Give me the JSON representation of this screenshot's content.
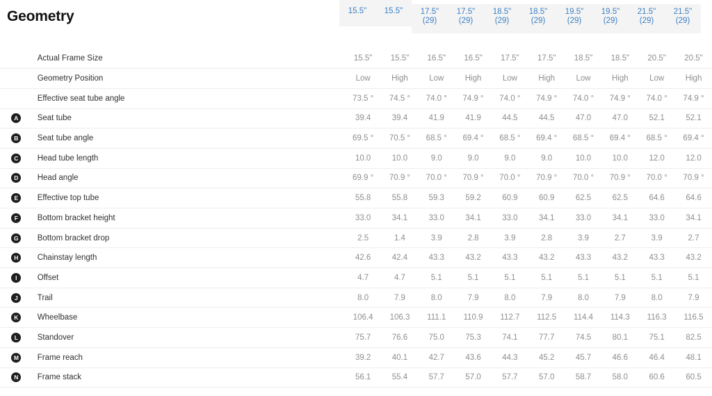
{
  "page_title": "Geometry",
  "colors": {
    "header_text": "#3a7fc4",
    "header_bg": "#f4f4f4",
    "label_text": "#2f2f2f",
    "value_text": "#8e8e8e",
    "badge_bg": "#1f1f1f",
    "row_divider": "#ededed"
  },
  "size_tabs": [
    {
      "size": "15.5\"",
      "wheel": "",
      "selected": true
    },
    {
      "size": "15.5\"",
      "wheel": "",
      "selected": true
    },
    {
      "size": "17.5\"",
      "wheel": "(29)",
      "selected": false
    },
    {
      "size": "17.5\"",
      "wheel": "(29)",
      "selected": false
    },
    {
      "size": "18.5\"",
      "wheel": "(29)",
      "selected": false
    },
    {
      "size": "18.5\"",
      "wheel": "(29)",
      "selected": false
    },
    {
      "size": "19.5\"",
      "wheel": "(29)",
      "selected": false
    },
    {
      "size": "19.5\"",
      "wheel": "(29)",
      "selected": false
    },
    {
      "size": "21.5\"",
      "wheel": "(29)",
      "selected": false
    },
    {
      "size": "21.5\"",
      "wheel": "(29)",
      "selected": false
    }
  ],
  "rows": [
    {
      "badge": "",
      "label": "Actual Frame Size",
      "values": [
        "15.5\"",
        "15.5\"",
        "16.5\"",
        "16.5\"",
        "17.5\"",
        "17.5\"",
        "18.5\"",
        "18.5\"",
        "20.5\"",
        "20.5\""
      ]
    },
    {
      "badge": "",
      "label": "Geometry Position",
      "values": [
        "Low",
        "High",
        "Low",
        "High",
        "Low",
        "High",
        "Low",
        "High",
        "Low",
        "High"
      ]
    },
    {
      "badge": "",
      "label": "Effective seat tube angle",
      "values": [
        "73.5 °",
        "74.5 °",
        "74.0 °",
        "74.9 °",
        "74.0 °",
        "74.9 °",
        "74.0 °",
        "74.9 °",
        "74.0 °",
        "74.9 °"
      ]
    },
    {
      "badge": "A",
      "label": "Seat tube",
      "values": [
        "39.4",
        "39.4",
        "41.9",
        "41.9",
        "44.5",
        "44.5",
        "47.0",
        "47.0",
        "52.1",
        "52.1"
      ]
    },
    {
      "badge": "B",
      "label": "Seat tube angle",
      "values": [
        "69.5 °",
        "70.5 °",
        "68.5 °",
        "69.4 °",
        "68.5 °",
        "69.4 °",
        "68.5 °",
        "69.4 °",
        "68.5 °",
        "69.4 °"
      ]
    },
    {
      "badge": "C",
      "label": "Head tube length",
      "values": [
        "10.0",
        "10.0",
        "9.0",
        "9.0",
        "9.0",
        "9.0",
        "10.0",
        "10.0",
        "12.0",
        "12.0"
      ]
    },
    {
      "badge": "D",
      "label": "Head angle",
      "values": [
        "69.9 °",
        "70.9 °",
        "70.0 °",
        "70.9 °",
        "70.0 °",
        "70.9 °",
        "70.0 °",
        "70.9 °",
        "70.0 °",
        "70.9 °"
      ]
    },
    {
      "badge": "E",
      "label": "Effective top tube",
      "values": [
        "55.8",
        "55.8",
        "59.3",
        "59.2",
        "60.9",
        "60.9",
        "62.5",
        "62.5",
        "64.6",
        "64.6"
      ]
    },
    {
      "badge": "F",
      "label": "Bottom bracket height",
      "values": [
        "33.0",
        "34.1",
        "33.0",
        "34.1",
        "33.0",
        "34.1",
        "33.0",
        "34.1",
        "33.0",
        "34.1"
      ]
    },
    {
      "badge": "G",
      "label": "Bottom bracket drop",
      "values": [
        "2.5",
        "1.4",
        "3.9",
        "2.8",
        "3.9",
        "2.8",
        "3.9",
        "2.7",
        "3.9",
        "2.7"
      ]
    },
    {
      "badge": "H",
      "label": "Chainstay length",
      "values": [
        "42.6",
        "42.4",
        "43.3",
        "43.2",
        "43.3",
        "43.2",
        "43.3",
        "43.2",
        "43.3",
        "43.2"
      ]
    },
    {
      "badge": "I",
      "label": "Offset",
      "values": [
        "4.7",
        "4.7",
        "5.1",
        "5.1",
        "5.1",
        "5.1",
        "5.1",
        "5.1",
        "5.1",
        "5.1"
      ]
    },
    {
      "badge": "J",
      "label": "Trail",
      "values": [
        "8.0",
        "7.9",
        "8.0",
        "7.9",
        "8.0",
        "7.9",
        "8.0",
        "7.9",
        "8.0",
        "7.9"
      ]
    },
    {
      "badge": "K",
      "label": "Wheelbase",
      "values": [
        "106.4",
        "106.3",
        "111.1",
        "110.9",
        "112.7",
        "112.5",
        "114.4",
        "114.3",
        "116.3",
        "116.5"
      ]
    },
    {
      "badge": "L",
      "label": "Standover",
      "values": [
        "75.7",
        "76.6",
        "75.0",
        "75.3",
        "74.1",
        "77.7",
        "74.5",
        "80.1",
        "75.1",
        "82.5"
      ]
    },
    {
      "badge": "M",
      "label": "Frame reach",
      "values": [
        "39.2",
        "40.1",
        "42.7",
        "43.6",
        "44.3",
        "45.2",
        "45.7",
        "46.6",
        "46.4",
        "48.1"
      ]
    },
    {
      "badge": "N",
      "label": "Frame stack",
      "values": [
        "56.1",
        "55.4",
        "57.7",
        "57.0",
        "57.7",
        "57.0",
        "58.7",
        "58.0",
        "60.6",
        "60.5"
      ]
    }
  ]
}
